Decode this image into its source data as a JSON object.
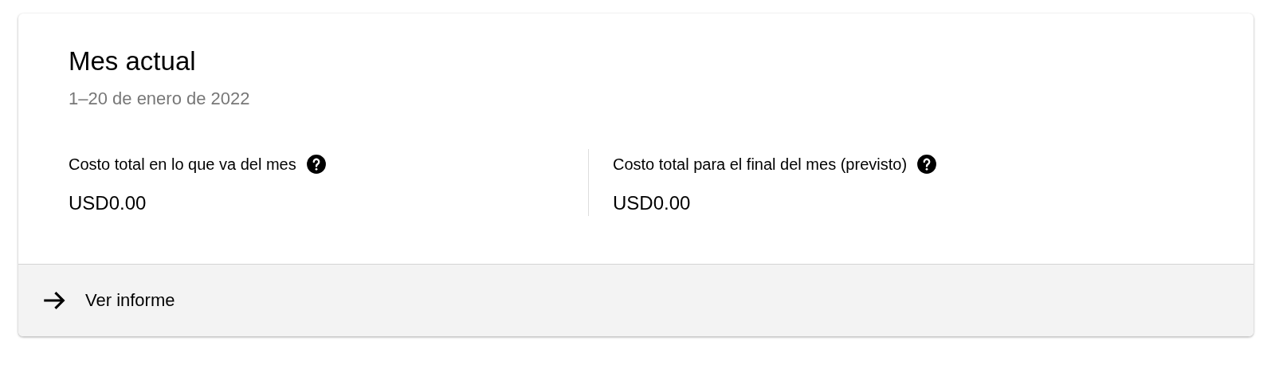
{
  "card": {
    "title": "Mes actual",
    "subtitle": "1–20 de enero de 2022",
    "metrics": [
      {
        "label": "Costo total en lo que va del mes",
        "value": "USD0.00"
      },
      {
        "label": "Costo total para el final del mes (previsto)",
        "value": "USD0.00"
      }
    ],
    "footer_link": "Ver informe"
  }
}
